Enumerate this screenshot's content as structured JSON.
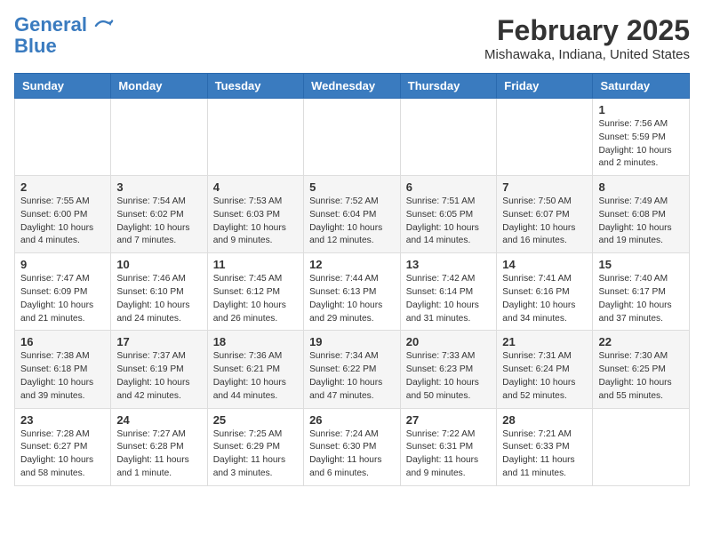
{
  "header": {
    "logo_line1": "General",
    "logo_line2": "Blue",
    "month": "February 2025",
    "location": "Mishawaka, Indiana, United States"
  },
  "weekdays": [
    "Sunday",
    "Monday",
    "Tuesday",
    "Wednesday",
    "Thursday",
    "Friday",
    "Saturday"
  ],
  "weeks": [
    [
      {
        "day": "",
        "info": ""
      },
      {
        "day": "",
        "info": ""
      },
      {
        "day": "",
        "info": ""
      },
      {
        "day": "",
        "info": ""
      },
      {
        "day": "",
        "info": ""
      },
      {
        "day": "",
        "info": ""
      },
      {
        "day": "1",
        "info": "Sunrise: 7:56 AM\nSunset: 5:59 PM\nDaylight: 10 hours and 2 minutes."
      }
    ],
    [
      {
        "day": "2",
        "info": "Sunrise: 7:55 AM\nSunset: 6:00 PM\nDaylight: 10 hours and 4 minutes."
      },
      {
        "day": "3",
        "info": "Sunrise: 7:54 AM\nSunset: 6:02 PM\nDaylight: 10 hours and 7 minutes."
      },
      {
        "day": "4",
        "info": "Sunrise: 7:53 AM\nSunset: 6:03 PM\nDaylight: 10 hours and 9 minutes."
      },
      {
        "day": "5",
        "info": "Sunrise: 7:52 AM\nSunset: 6:04 PM\nDaylight: 10 hours and 12 minutes."
      },
      {
        "day": "6",
        "info": "Sunrise: 7:51 AM\nSunset: 6:05 PM\nDaylight: 10 hours and 14 minutes."
      },
      {
        "day": "7",
        "info": "Sunrise: 7:50 AM\nSunset: 6:07 PM\nDaylight: 10 hours and 16 minutes."
      },
      {
        "day": "8",
        "info": "Sunrise: 7:49 AM\nSunset: 6:08 PM\nDaylight: 10 hours and 19 minutes."
      }
    ],
    [
      {
        "day": "9",
        "info": "Sunrise: 7:47 AM\nSunset: 6:09 PM\nDaylight: 10 hours and 21 minutes."
      },
      {
        "day": "10",
        "info": "Sunrise: 7:46 AM\nSunset: 6:10 PM\nDaylight: 10 hours and 24 minutes."
      },
      {
        "day": "11",
        "info": "Sunrise: 7:45 AM\nSunset: 6:12 PM\nDaylight: 10 hours and 26 minutes."
      },
      {
        "day": "12",
        "info": "Sunrise: 7:44 AM\nSunset: 6:13 PM\nDaylight: 10 hours and 29 minutes."
      },
      {
        "day": "13",
        "info": "Sunrise: 7:42 AM\nSunset: 6:14 PM\nDaylight: 10 hours and 31 minutes."
      },
      {
        "day": "14",
        "info": "Sunrise: 7:41 AM\nSunset: 6:16 PM\nDaylight: 10 hours and 34 minutes."
      },
      {
        "day": "15",
        "info": "Sunrise: 7:40 AM\nSunset: 6:17 PM\nDaylight: 10 hours and 37 minutes."
      }
    ],
    [
      {
        "day": "16",
        "info": "Sunrise: 7:38 AM\nSunset: 6:18 PM\nDaylight: 10 hours and 39 minutes."
      },
      {
        "day": "17",
        "info": "Sunrise: 7:37 AM\nSunset: 6:19 PM\nDaylight: 10 hours and 42 minutes."
      },
      {
        "day": "18",
        "info": "Sunrise: 7:36 AM\nSunset: 6:21 PM\nDaylight: 10 hours and 44 minutes."
      },
      {
        "day": "19",
        "info": "Sunrise: 7:34 AM\nSunset: 6:22 PM\nDaylight: 10 hours and 47 minutes."
      },
      {
        "day": "20",
        "info": "Sunrise: 7:33 AM\nSunset: 6:23 PM\nDaylight: 10 hours and 50 minutes."
      },
      {
        "day": "21",
        "info": "Sunrise: 7:31 AM\nSunset: 6:24 PM\nDaylight: 10 hours and 52 minutes."
      },
      {
        "day": "22",
        "info": "Sunrise: 7:30 AM\nSunset: 6:25 PM\nDaylight: 10 hours and 55 minutes."
      }
    ],
    [
      {
        "day": "23",
        "info": "Sunrise: 7:28 AM\nSunset: 6:27 PM\nDaylight: 10 hours and 58 minutes."
      },
      {
        "day": "24",
        "info": "Sunrise: 7:27 AM\nSunset: 6:28 PM\nDaylight: 11 hours and 1 minute."
      },
      {
        "day": "25",
        "info": "Sunrise: 7:25 AM\nSunset: 6:29 PM\nDaylight: 11 hours and 3 minutes."
      },
      {
        "day": "26",
        "info": "Sunrise: 7:24 AM\nSunset: 6:30 PM\nDaylight: 11 hours and 6 minutes."
      },
      {
        "day": "27",
        "info": "Sunrise: 7:22 AM\nSunset: 6:31 PM\nDaylight: 11 hours and 9 minutes."
      },
      {
        "day": "28",
        "info": "Sunrise: 7:21 AM\nSunset: 6:33 PM\nDaylight: 11 hours and 11 minutes."
      },
      {
        "day": "",
        "info": ""
      }
    ]
  ]
}
